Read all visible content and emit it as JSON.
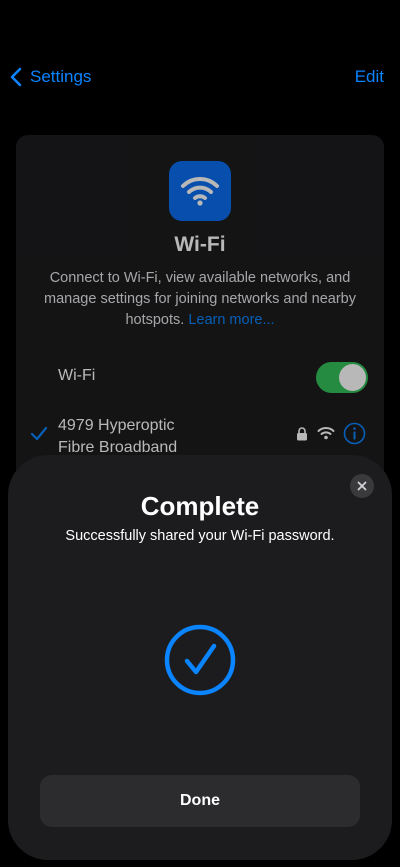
{
  "nav": {
    "back_label": "Settings",
    "edit_label": "Edit"
  },
  "wifi_card": {
    "title": "Wi-Fi",
    "description": "Connect to Wi-Fi, view available networks, and manage settings for joining networks and nearby hotspots.",
    "learn_more": "Learn more...",
    "wifi_toggle_label": "Wi-Fi",
    "wifi_enabled": true,
    "connected_network": {
      "name_line1": "4979 Hyperoptic",
      "name_line2": "Fibre Broadband",
      "secured": true
    }
  },
  "sheet": {
    "title": "Complete",
    "subtitle": "Successfully shared your Wi-Fi password.",
    "done_label": "Done"
  },
  "colors": {
    "accent": "#0a84ff",
    "toggle_on": "#32c159",
    "background": "#000000",
    "card": "#1c1c1e"
  },
  "icons": {
    "back": "chevron-left-icon",
    "app": "wifi-icon",
    "check": "checkmark-icon",
    "lock": "lock-icon",
    "signal": "wifi-signal-icon",
    "info": "info-icon",
    "close": "close-icon",
    "success": "checkmark-circle-icon"
  }
}
